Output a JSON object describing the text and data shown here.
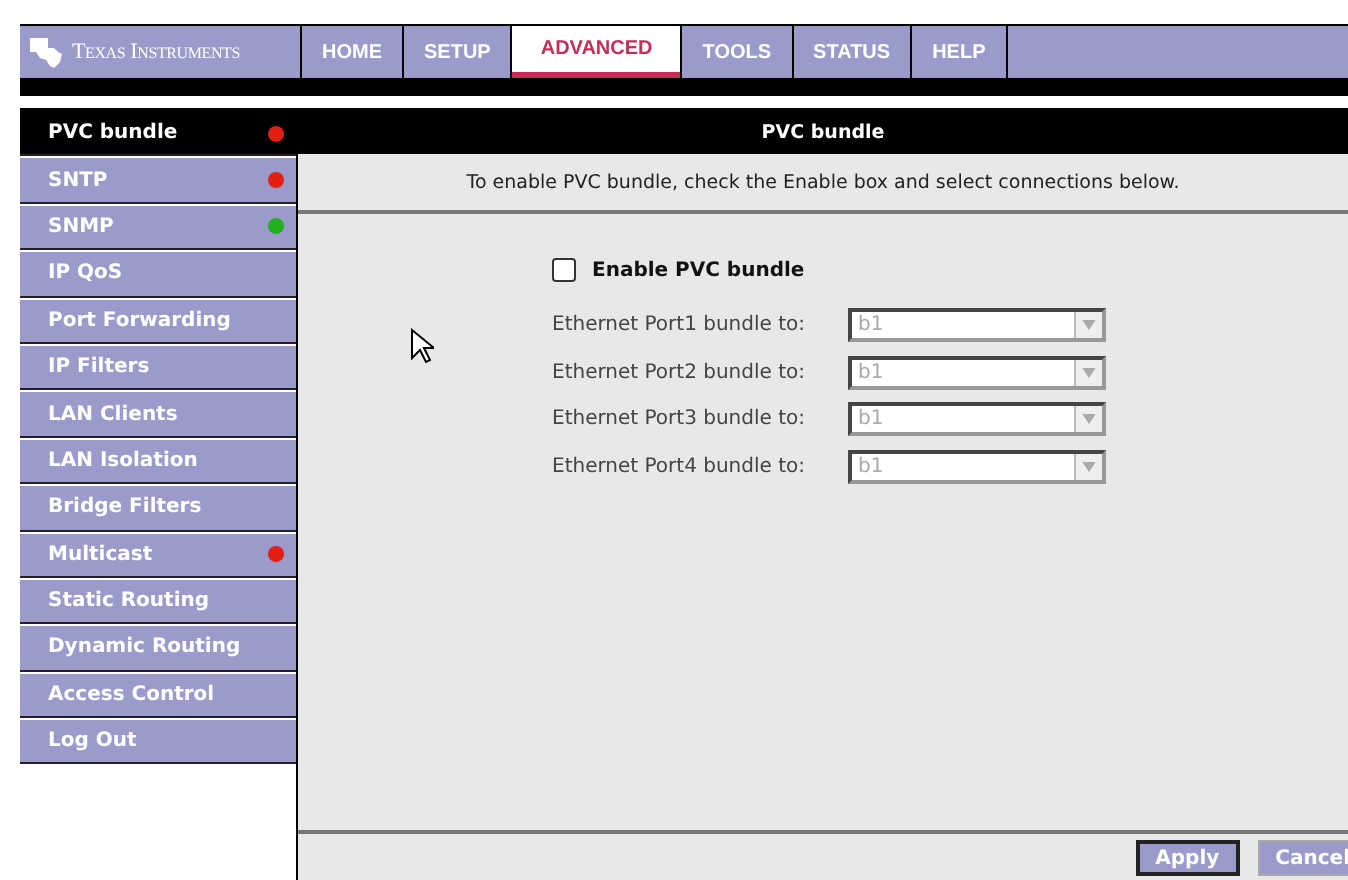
{
  "brand": "Texas Instruments",
  "tabs": [
    {
      "label": "HOME",
      "selected": false
    },
    {
      "label": "SETUP",
      "selected": false
    },
    {
      "label": "ADVANCED",
      "selected": true
    },
    {
      "label": "TOOLS",
      "selected": false
    },
    {
      "label": "STATUS",
      "selected": false
    },
    {
      "label": "HELP",
      "selected": false
    }
  ],
  "sidebar": {
    "items": [
      {
        "label": "PVC bundle",
        "selected": true,
        "color": "#e02010"
      },
      {
        "label": "SNTP",
        "selected": false,
        "color": "#e02010"
      },
      {
        "label": "SNMP",
        "selected": false,
        "color": "#20b020"
      },
      {
        "label": "IP QoS",
        "selected": false
      },
      {
        "label": "Port Forwarding",
        "selected": false
      },
      {
        "label": "IP Filters",
        "selected": false
      },
      {
        "label": "LAN Clients",
        "selected": false
      },
      {
        "label": "LAN Isolation",
        "selected": false
      },
      {
        "label": "Bridge Filters",
        "selected": false
      },
      {
        "label": "Multicast",
        "selected": false,
        "color": "#e02010"
      },
      {
        "label": "Static Routing",
        "selected": false
      },
      {
        "label": "Dynamic Routing",
        "selected": false
      },
      {
        "label": "Access Control",
        "selected": false
      },
      {
        "label": "Log Out",
        "selected": false
      }
    ]
  },
  "panel": {
    "title": "PVC bundle",
    "description": "To enable PVC bundle, check the Enable box and select connections below.",
    "enable": {
      "label": "Enable PVC bundle",
      "checked": false
    },
    "ports": [
      {
        "label": "Ethernet Port1 bundle to:",
        "value": "b1",
        "disabled": true
      },
      {
        "label": "Ethernet Port2 bundle to:",
        "value": "b1",
        "disabled": true
      },
      {
        "label": "Ethernet Port3 bundle to:",
        "value": "b1",
        "disabled": true
      },
      {
        "label": "Ethernet Port4 bundle to:",
        "value": "b1",
        "disabled": true
      }
    ]
  },
  "buttons": [
    "Apply",
    "Cancel"
  ]
}
